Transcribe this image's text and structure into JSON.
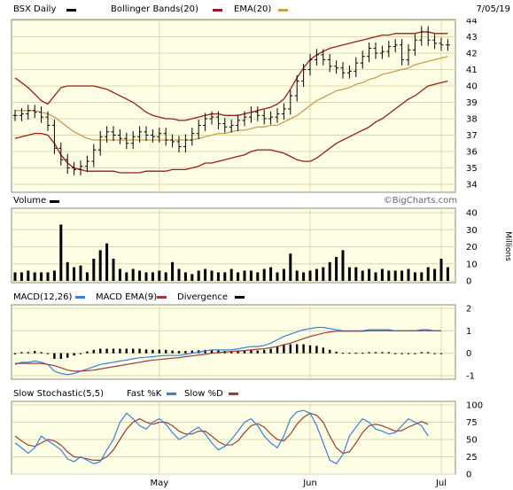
{
  "header": {
    "ticker_label": "BSX Daily",
    "bb_label": "Bollinger Bands(20)",
    "ema_label": "EMA(20)",
    "date": "7/05/19"
  },
  "volume_panel": {
    "title": "Volume",
    "watermark": "©BigCharts.com",
    "unit": "Millions"
  },
  "macd_panel": {
    "label_macd": "MACD(12,26)",
    "label_ema": "MACD EMA(9)",
    "label_div": "Divergence"
  },
  "stoch_panel": {
    "label_main": "Slow Stochastic(5,5)",
    "label_fast": "Fast %K",
    "label_slow": "Slow %D"
  },
  "colors": {
    "bg_plot": "#ffffe6",
    "grid": "#d8d8a8",
    "upper_band": "#9e1a1a",
    "ema": "#c8a050",
    "macd": "#3a7fdc",
    "macd_ema": "#9e3a3a",
    "stoch_fast": "#3a7fdc",
    "stoch_slow": "#9e3a3a"
  },
  "chart_data": [
    {
      "type": "ohlc",
      "ylim": [
        34,
        44
      ],
      "yticks": [
        34,
        35,
        36,
        37,
        38,
        39,
        40,
        41,
        42,
        43,
        44
      ],
      "xticks": [
        "May",
        "Jun",
        "Jul"
      ],
      "x_tick_day_index": [
        22,
        45,
        65
      ],
      "close": [
        38.2,
        38.3,
        38.5,
        38.4,
        38.1,
        37.6,
        36.2,
        35.5,
        35.0,
        34.9,
        35.1,
        35.4,
        36.1,
        36.9,
        37.2,
        37.0,
        36.8,
        36.5,
        36.9,
        37.2,
        37.0,
        36.9,
        37.1,
        36.7,
        36.6,
        36.3,
        36.7,
        37.1,
        37.6,
        38.0,
        38.1,
        37.7,
        37.5,
        37.6,
        37.9,
        38.1,
        38.4,
        38.2,
        38.0,
        38.1,
        38.3,
        38.6,
        39.4,
        40.3,
        41.0,
        41.6,
        41.9,
        41.6,
        41.2,
        41.1,
        40.8,
        40.9,
        41.4,
        41.8,
        42.3,
        42.0,
        42.1,
        42.4,
        42.5,
        41.6,
        42.2,
        42.8,
        43.3,
        42.8,
        42.6,
        42.5,
        42.5
      ],
      "bollinger_upper": [
        40.5,
        40.2,
        39.9,
        39.5,
        39.1,
        38.9,
        39.4,
        39.9,
        40.0,
        40.0,
        40.0,
        40.0,
        40.0,
        39.9,
        39.8,
        39.6,
        39.4,
        39.2,
        39.0,
        38.7,
        38.4,
        38.2,
        38.1,
        38.0,
        38.0,
        37.9,
        37.9,
        38.0,
        38.1,
        38.2,
        38.3,
        38.3,
        38.2,
        38.2,
        38.2,
        38.3,
        38.4,
        38.5,
        38.6,
        38.7,
        38.9,
        39.2,
        39.8,
        40.5,
        41.1,
        41.6,
        41.9,
        42.1,
        42.3,
        42.4,
        42.5,
        42.6,
        42.7,
        42.8,
        42.9,
        43.0,
        43.1,
        43.1,
        43.2,
        43.2,
        43.2,
        43.2,
        43.3,
        43.3,
        43.2,
        43.2,
        43.2
      ],
      "bollinger_lower": [
        36.8,
        36.9,
        37.0,
        37.1,
        37.1,
        37.0,
        36.5,
        35.8,
        35.3,
        35.0,
        34.9,
        34.8,
        34.8,
        34.8,
        34.8,
        34.8,
        34.7,
        34.7,
        34.7,
        34.7,
        34.8,
        34.8,
        34.8,
        34.8,
        34.9,
        34.9,
        34.9,
        35.0,
        35.1,
        35.3,
        35.3,
        35.4,
        35.5,
        35.6,
        35.7,
        35.8,
        36.0,
        36.1,
        36.1,
        36.1,
        36.0,
        35.9,
        35.7,
        35.5,
        35.4,
        35.4,
        35.6,
        35.9,
        36.2,
        36.5,
        36.7,
        36.9,
        37.1,
        37.3,
        37.5,
        37.8,
        38.0,
        38.3,
        38.6,
        38.9,
        39.2,
        39.4,
        39.7,
        40.0,
        40.1,
        40.2,
        40.3
      ],
      "ema20": [
        38.5,
        38.5,
        38.5,
        38.5,
        38.4,
        38.3,
        38.1,
        37.8,
        37.5,
        37.2,
        37.0,
        36.8,
        36.7,
        36.7,
        36.7,
        36.7,
        36.7,
        36.7,
        36.7,
        36.7,
        36.7,
        36.7,
        36.7,
        36.7,
        36.7,
        36.7,
        36.7,
        36.7,
        36.8,
        36.9,
        37.0,
        37.1,
        37.1,
        37.2,
        37.3,
        37.3,
        37.4,
        37.5,
        37.5,
        37.6,
        37.6,
        37.8,
        38.0,
        38.2,
        38.5,
        38.8,
        39.1,
        39.3,
        39.5,
        39.7,
        39.8,
        39.9,
        40.1,
        40.2,
        40.4,
        40.5,
        40.7,
        40.8,
        40.9,
        41.0,
        41.1,
        41.3,
        41.4,
        41.5,
        41.6,
        41.7,
        41.8
      ]
    },
    {
      "type": "bar",
      "title": "Volume",
      "ylabel": "Millions",
      "ylim": [
        0,
        40
      ],
      "yticks": [
        0,
        10,
        20,
        30,
        40
      ],
      "values": [
        5,
        5,
        6,
        5,
        5,
        5,
        6,
        33,
        11,
        8,
        9,
        5,
        13,
        18,
        22,
        13,
        7,
        5,
        7,
        6,
        5,
        5,
        6,
        5,
        11,
        7,
        5,
        4,
        6,
        7,
        6,
        5,
        5,
        7,
        5,
        6,
        6,
        5,
        7,
        8,
        5,
        7,
        16,
        6,
        5,
        6,
        7,
        8,
        11,
        14,
        18,
        8,
        8,
        6,
        7,
        5,
        7,
        6,
        6,
        6,
        7,
        5,
        5,
        8,
        7,
        13,
        8,
        7,
        5,
        5
      ]
    },
    {
      "type": "line",
      "ylim": [
        -1,
        2
      ],
      "yticks": [
        -1,
        0,
        1,
        2
      ],
      "series": [
        {
          "name": "MACD(12,26)",
          "values": [
            -0.5,
            -0.4,
            -0.4,
            -0.35,
            -0.4,
            -0.5,
            -0.8,
            -0.9,
            -0.95,
            -0.9,
            -0.8,
            -0.7,
            -0.6,
            -0.5,
            -0.45,
            -0.4,
            -0.35,
            -0.3,
            -0.25,
            -0.2,
            -0.18,
            -0.15,
            -0.12,
            -0.1,
            -0.1,
            -0.1,
            -0.05,
            0.0,
            0.05,
            0.1,
            0.15,
            0.15,
            0.15,
            0.15,
            0.2,
            0.25,
            0.3,
            0.3,
            0.35,
            0.45,
            0.6,
            0.75,
            0.85,
            0.95,
            1.05,
            1.1,
            1.15,
            1.15,
            1.1,
            1.05,
            1.0,
            1.0,
            1.0,
            1.0,
            1.05,
            1.05,
            1.05,
            1.05,
            1.0,
            1.0,
            1.0,
            1.0,
            1.05,
            1.05,
            1.0,
            1.0
          ]
        },
        {
          "name": "MACD EMA(9)",
          "values": [
            -0.45,
            -0.45,
            -0.45,
            -0.45,
            -0.45,
            -0.5,
            -0.55,
            -0.65,
            -0.75,
            -0.8,
            -0.8,
            -0.78,
            -0.75,
            -0.7,
            -0.65,
            -0.6,
            -0.55,
            -0.5,
            -0.45,
            -0.4,
            -0.35,
            -0.3,
            -0.28,
            -0.25,
            -0.22,
            -0.2,
            -0.15,
            -0.12,
            -0.08,
            -0.05,
            0.0,
            0.03,
            0.05,
            0.08,
            0.1,
            0.12,
            0.15,
            0.18,
            0.2,
            0.25,
            0.3,
            0.38,
            0.45,
            0.55,
            0.65,
            0.75,
            0.82,
            0.9,
            0.95,
            0.98,
            0.98,
            0.98,
            0.98,
            0.98,
            1.0,
            1.0,
            1.0,
            1.0,
            1.0,
            1.0,
            1.0,
            1.0,
            1.0,
            1.0,
            1.0,
            1.0
          ]
        },
        {
          "name": "Divergence",
          "values": [
            -0.05,
            0.05,
            0.05,
            0.1,
            0.05,
            0.0,
            -0.25,
            -0.25,
            -0.2,
            -0.1,
            0.0,
            0.08,
            0.15,
            0.2,
            0.2,
            0.2,
            0.2,
            0.2,
            0.2,
            0.2,
            0.17,
            0.15,
            0.16,
            0.15,
            0.12,
            0.1,
            0.1,
            0.12,
            0.13,
            0.15,
            0.15,
            0.12,
            0.1,
            0.07,
            0.1,
            0.13,
            0.15,
            0.12,
            0.15,
            0.2,
            0.3,
            0.37,
            0.4,
            0.4,
            0.4,
            0.35,
            0.33,
            0.25,
            0.15,
            0.07,
            0.02,
            0.02,
            0.02,
            0.02,
            0.05,
            0.05,
            0.05,
            0.05,
            0.0,
            0.0,
            0.0,
            0.0,
            0.05,
            0.05,
            0.0,
            0.0
          ]
        }
      ]
    },
    {
      "type": "line",
      "ylim": [
        0,
        100
      ],
      "yticks": [
        0,
        25,
        50,
        75,
        100
      ],
      "series": [
        {
          "name": "Fast %K",
          "values": [
            45,
            38,
            30,
            38,
            55,
            48,
            42,
            35,
            22,
            18,
            25,
            20,
            15,
            18,
            35,
            50,
            75,
            88,
            80,
            70,
            65,
            75,
            80,
            72,
            60,
            50,
            55,
            62,
            68,
            58,
            45,
            35,
            40,
            50,
            62,
            75,
            80,
            70,
            55,
            45,
            38,
            55,
            80,
            90,
            92,
            88,
            70,
            45,
            20,
            15,
            28,
            55,
            68,
            80,
            75,
            65,
            62,
            58,
            60,
            70,
            80,
            75,
            70,
            55
          ],
          "x_start": 0
        },
        {
          "name": "Slow %D",
          "values": [
            55,
            48,
            42,
            40,
            45,
            50,
            48,
            42,
            32,
            25,
            24,
            22,
            20,
            20,
            25,
            35,
            50,
            65,
            75,
            80,
            75,
            72,
            75,
            75,
            70,
            62,
            58,
            58,
            62,
            62,
            55,
            47,
            42,
            42,
            48,
            60,
            70,
            73,
            68,
            58,
            50,
            48,
            58,
            72,
            82,
            88,
            85,
            75,
            55,
            38,
            30,
            32,
            45,
            60,
            70,
            72,
            70,
            66,
            62,
            63,
            68,
            72,
            76,
            72
          ],
          "x_start": 0
        }
      ]
    }
  ]
}
